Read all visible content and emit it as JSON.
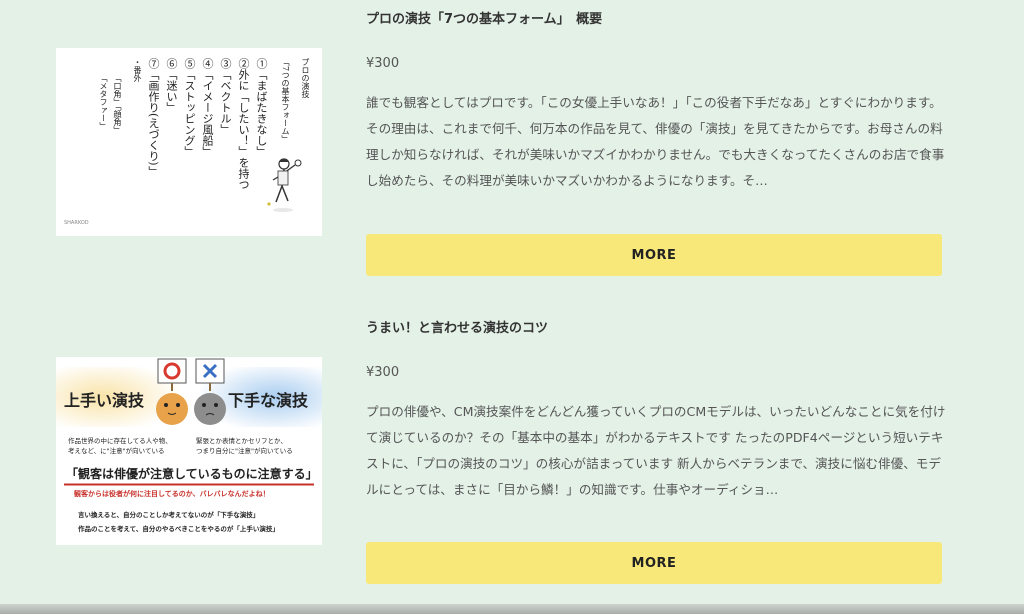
{
  "products": [
    {
      "title": "プロの演技「7つの基本フォーム」　概要",
      "price": "¥300",
      "description": "誰でも観客としてはプロです。「この女優上手いなあ！」「この役者下手だなあ」とすぐにわかります。その理由は、これまで何千、何万本の作品を見て、俳優の「演技」を見てきたからです。お母さんの料理しか知らなければ、それが美味いかマズイかわかりません。でも大きくなってたくさんのお店で食事し始めたら、その料理が美味いかマズいかわかるようになります。そ…",
      "more_label": "MORE",
      "thumbnail": {
        "heading_1": "プロの演技",
        "heading_2": "「7つの基本フォーム」",
        "items": [
          "①「まばたきなし」",
          "②外に「したい！」を持つ",
          "③「ベクトル」",
          "④「イメージ風船」",
          "⑤「ストッピング」",
          "⑥「迷い」",
          "⑦「画作り(えづくり)」"
        ],
        "bangai": "・番外",
        "bangai_items": [
          "「口角」「顔角」",
          "「メタファー」"
        ],
        "mark": "SHARKOD"
      }
    },
    {
      "title": "うまい！と言わせる演技のコツ",
      "price": "¥300",
      "description": "プロの俳優や、CM演技案件をどんどん獲っていくプロのCMモデルは、いったいどんなことに気を付けて演じているのか？その「基本中の基本」がわかるテキストです たったのPDF4ページという短いテキストに、「プロの演技のコツ」の核心が詰まっています 新人からベテランまで、演技に悩む俳優、モデルにとっては、まさに「目から鱗！」の知識です。仕事やオーディショ…",
      "more_label": "MORE",
      "thumbnail": {
        "good": "上手い演技",
        "bad": "下手な演技",
        "left_note_1": "作品世界の中に存在してる人や物、",
        "left_note_2": "考えなど、に\"注意\"が向いている",
        "right_note_1": "緊張とか表情とかセリフとか、",
        "right_note_2": "つまり自分に\"注意\"が向いている",
        "main": "「観客は俳優が注意しているものに注意する」",
        "red": "観客からは役者が何に注目してるのか、バレバレなんだよね！",
        "bottom_1": "言い換えると、自分のことしか考えてないのが「下手な演技」",
        "bottom_2": "作品のことを考えて、自分のやるべきことをやるのが「上手い演技」"
      }
    }
  ],
  "colors": {
    "background": "#e3f1e7",
    "button": "#f8e87a",
    "red_text": "#c8302a",
    "good_bg": "#f6d99a",
    "bad_bg": "#a9cdf0"
  }
}
